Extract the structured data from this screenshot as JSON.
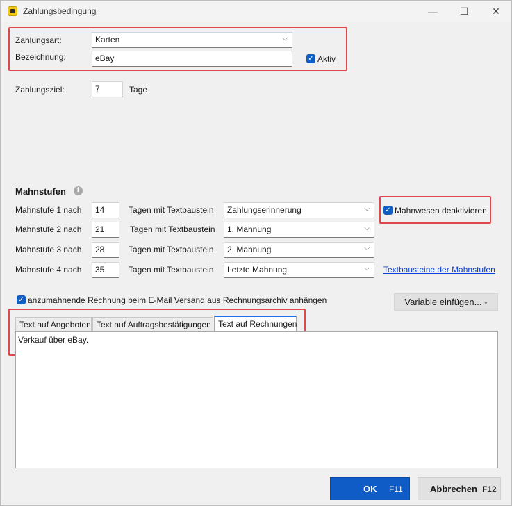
{
  "window": {
    "title": "Zahlungsbedingung",
    "minimize": "—",
    "maximize": "☐",
    "close": "✕"
  },
  "form": {
    "zahlungsart_label": "Zahlungsart:",
    "zahlungsart_value": "Karten",
    "bezeichnung_label": "Bezeichnung:",
    "bezeichnung_value": "eBay",
    "aktiv_label": "Aktiv",
    "zahlungsziel_label": "Zahlungsziel:",
    "zahlungsziel_value": "7",
    "tage_label": "Tage"
  },
  "mahnstufen": {
    "title": "Mahnstufen",
    "info_glyph": "i",
    "textbaustein_label": "Tagen mit Textbaustein",
    "rows": [
      {
        "label": "Mahnstufe 1 nach",
        "days": "14",
        "template": "Zahlungserinnerung"
      },
      {
        "label": "Mahnstufe 2 nach",
        "days": "21",
        "template": "1. Mahnung"
      },
      {
        "label": "Mahnstufe 3 nach",
        "days": "28",
        "template": "2. Mahnung"
      },
      {
        "label": "Mahnstufe 4 nach",
        "days": "35",
        "template": "Letzte Mahnung"
      }
    ],
    "deactivate_label": "Mahnwesen deaktivieren",
    "link_text": "Textbausteine der Mahnstufen"
  },
  "attach": {
    "label": "anzumahnende Rechnung beim E-Mail Versand aus Rechnungsarchiv anhängen"
  },
  "variable_button": "Variable einfügen...",
  "tabs": [
    {
      "label": "Text auf Angeboten"
    },
    {
      "label": "Text auf Auftragsbestätigungen"
    },
    {
      "label": "Text auf Rechnungen"
    }
  ],
  "textarea_value": "Verkauf über eBay.",
  "footer": {
    "ok_label": "OK",
    "ok_key": "F11",
    "cancel_label": "Abbrechen",
    "cancel_key": "F12"
  },
  "colors": {
    "accent": "#0f5cc7",
    "highlight": "#e0474c",
    "link": "#0b3fd8"
  }
}
